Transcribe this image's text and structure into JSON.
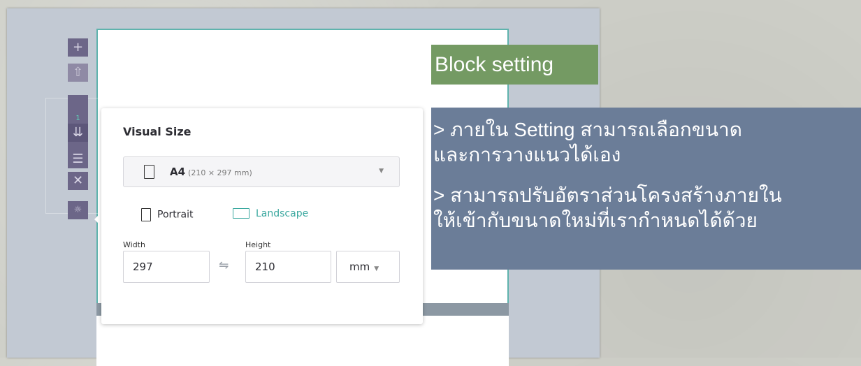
{
  "toolbar": {
    "add_icon": "+",
    "upload_icon": "⇧",
    "page_number": "1",
    "insert_icon": "⇊",
    "layout_icon": "☰",
    "delete_icon": "✕",
    "settings_icon": "☼"
  },
  "panel": {
    "title": "Visual Size",
    "size_name": "A4",
    "size_dims": "(210 × 297 mm)",
    "caret": "▼",
    "portrait_label": "Portrait",
    "landscape_label": "Landscape",
    "width_label": "Width",
    "height_label": "Height",
    "width_value": "297",
    "swap_icon": "⇋",
    "height_value": "210",
    "unit_value": "mm",
    "unit_caret": "▼"
  },
  "annotation": {
    "heading": "Block setting",
    "line1": "> ภายใน Setting สามารถเลือกขนาด",
    "line2": "และการวางแนวได้เอง",
    "line3": "> สามารถปรับอัตราส่วนโครงสร้างภายใน",
    "line4": "ให้เข้ากับขนาดใหม่ที่เรากำหนดได้ด้วย"
  },
  "colors": {
    "accent_teal": "#3aa89f",
    "toolbar": "#6c6688",
    "annotation_green": "#749a63",
    "annotation_blue": "#6b7d98"
  }
}
